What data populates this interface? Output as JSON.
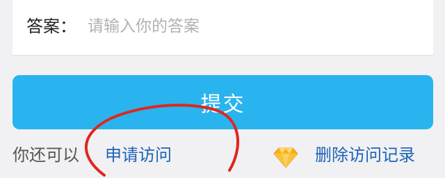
{
  "answer": {
    "label": "答案：",
    "placeholder": "请输入你的答案",
    "value": ""
  },
  "submit": {
    "label": "提交"
  },
  "hint": {
    "prefix": "你还可以",
    "apply_link": "申请访问",
    "delete_link": "删除访问记录",
    "delete_icon": "diamond-icon"
  },
  "colors": {
    "accent": "#29b4ef",
    "link": "#1d63b8",
    "annotation": "#e0261f"
  }
}
